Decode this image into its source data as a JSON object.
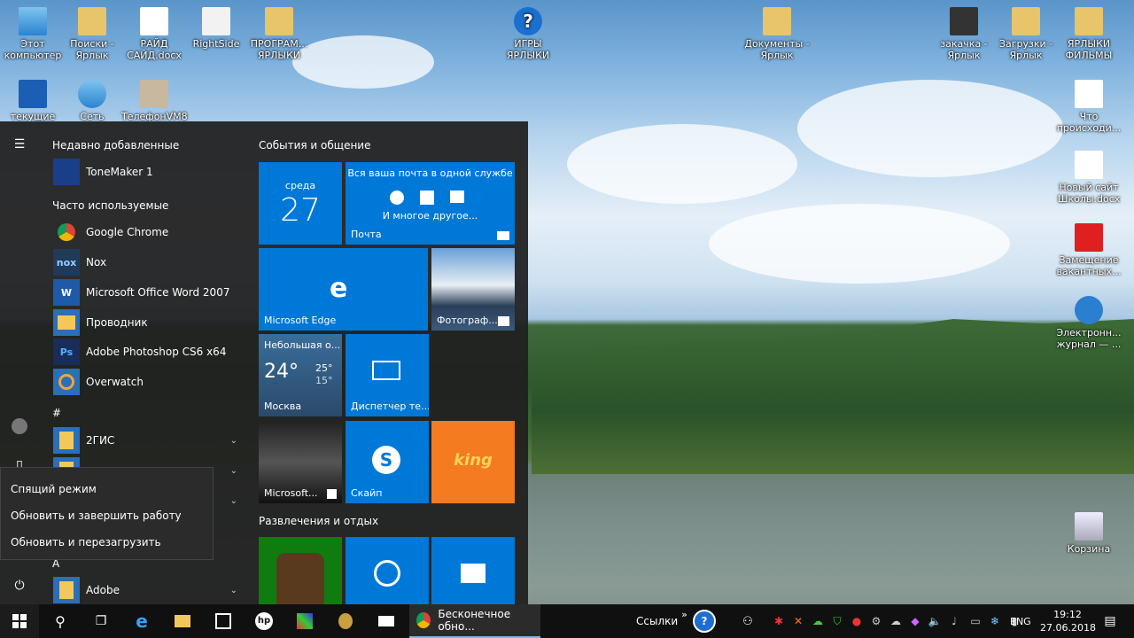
{
  "desktop": {
    "icons": [
      {
        "label": "Этот компьютер"
      },
      {
        "label": "Поиски - Ярлык"
      },
      {
        "label": "РАЙД САЙД.docx"
      },
      {
        "label": "RightSide"
      },
      {
        "label": "ПРОГРАМ... ЯРЛЫКИ"
      },
      {
        "label": "ИГРЫ ЯРЛЫКИ"
      },
      {
        "label": "Документы - Ярлык"
      },
      {
        "label": "закачка - Ярлык"
      },
      {
        "label": "Загрузки - Ярлык"
      },
      {
        "label": "ЯРЛЫКИ ФИЛЬМЫ"
      },
      {
        "label": "текущие"
      },
      {
        "label": "Сеть"
      },
      {
        "label": "ТелефонVM8"
      },
      {
        "label": "Что происходи..."
      },
      {
        "label": "Новый сайт Школы.docx"
      },
      {
        "label": "Замещение вакантных..."
      },
      {
        "label": "Электронн... журнал — ..."
      },
      {
        "label": "Корзина"
      }
    ]
  },
  "start_menu": {
    "recent_header": "Недавно добавленные",
    "frequent_header": "Часто используемые",
    "hash_header": "#",
    "a_header": "A",
    "recent_apps": [
      {
        "label": "ToneMaker 1"
      }
    ],
    "frequent_apps": [
      {
        "label": "Google Chrome"
      },
      {
        "label": "Nox"
      },
      {
        "label": "Microsoft Office Word 2007"
      },
      {
        "label": "Проводник"
      },
      {
        "label": "Adobe Photoshop CS6 x64"
      },
      {
        "label": "Overwatch"
      }
    ],
    "hash_apps": [
      {
        "label": "2ГИС"
      }
    ],
    "a_apps": [
      {
        "label": "Adobe"
      }
    ],
    "group1_title": "События и общение",
    "group2_title": "Развлечения и отдых",
    "calendar": {
      "day_name": "среда",
      "day_num": "27"
    },
    "mail": {
      "header": "Вся ваша почта в одной службе",
      "sub": "И многое другое...",
      "label": "Почта"
    },
    "edge": {
      "label": "Microsoft Edge"
    },
    "photos": {
      "label": "Фотограф..."
    },
    "weather": {
      "desc": "Небольшая о...",
      "temp": "24°",
      "high": "25°",
      "low": "15°",
      "city": "Москва"
    },
    "devices": {
      "label": "Диспетчер те..."
    },
    "store_tile": {
      "label": "Microsoft..."
    },
    "skype": {
      "label": "Скайп"
    },
    "king": {
      "label": "king"
    }
  },
  "power_menu": {
    "items": [
      {
        "label": "Спящий режим"
      },
      {
        "label": "Обновить и завершить работу"
      },
      {
        "label": "Обновить и перезагрузить"
      }
    ]
  },
  "taskbar": {
    "chrome_window": "Бесконечное обно...",
    "links_label": "Ссылки",
    "links_chevron": "»",
    "lang": "ENG",
    "time": "19:12",
    "date": "27.06.2018"
  },
  "colors": {
    "accent": "#0078d7",
    "tile_blue": "#0063b1",
    "king_orange": "#f47b20",
    "xbox_green": "#107c10"
  }
}
